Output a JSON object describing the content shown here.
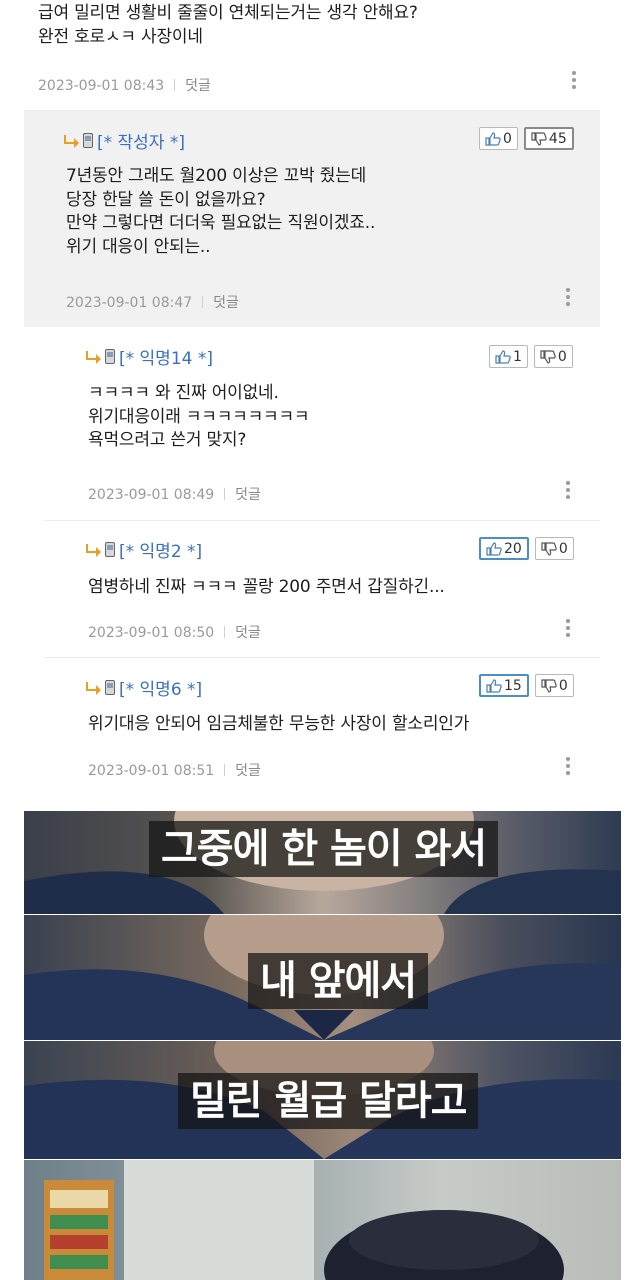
{
  "comments": [
    {
      "lines": [
        "급여 밀리면 생활비 줄줄이 연체되는거는 생각 안해요?",
        "완전 호로ㅅㅋ 사장이네"
      ],
      "date": "2023-09-01 08:43",
      "reply_label": "덧글"
    },
    {
      "author": "[* 작성자 *]",
      "up": "0",
      "down": "45",
      "lines": [
        "7년동안 그래도 월200 이상은 꼬박 줬는데",
        "당장 한달 쓸 돈이 없을까요?",
        "만약 그렇다면 더더욱 필요없는 직원이겠죠..",
        "위기 대응이 안되는.."
      ],
      "date": "2023-09-01 08:47",
      "reply_label": "덧글"
    },
    {
      "author": "[* 익명14 *]",
      "up": "1",
      "down": "0",
      "lines": [
        "ㅋㅋㅋㅋ 와 진짜 어이없네.",
        "위기대응이래 ㅋㅋㅋㅋㅋㅋㅋㅋ",
        "욕먹으려고 쓴거 맞지?"
      ],
      "date": "2023-09-01 08:49",
      "reply_label": "덧글"
    },
    {
      "author": "[* 익명2 *]",
      "up": "20",
      "down": "0",
      "lines": [
        "염병하네 진짜 ㅋㅋㅋ 꼴랑 200 주면서 갑질하긴..."
      ],
      "date": "2023-09-01 08:50",
      "reply_label": "덧글"
    },
    {
      "author": "[* 익명6 *]",
      "up": "15",
      "down": "0",
      "lines": [
        "위기대응 안되어 임금체불한 무능한 사장이 할소리인가"
      ],
      "date": "2023-09-01 08:51",
      "reply_label": "덧글"
    }
  ],
  "meme": {
    "captions": [
      "그중에 한 놈이 와서",
      "내 앞에서",
      "밀린 월급 달라고"
    ]
  },
  "colors": {
    "author": "#3a6fc2",
    "vote_highlight": "#4a90c8",
    "shade": "#f1f1f1"
  }
}
